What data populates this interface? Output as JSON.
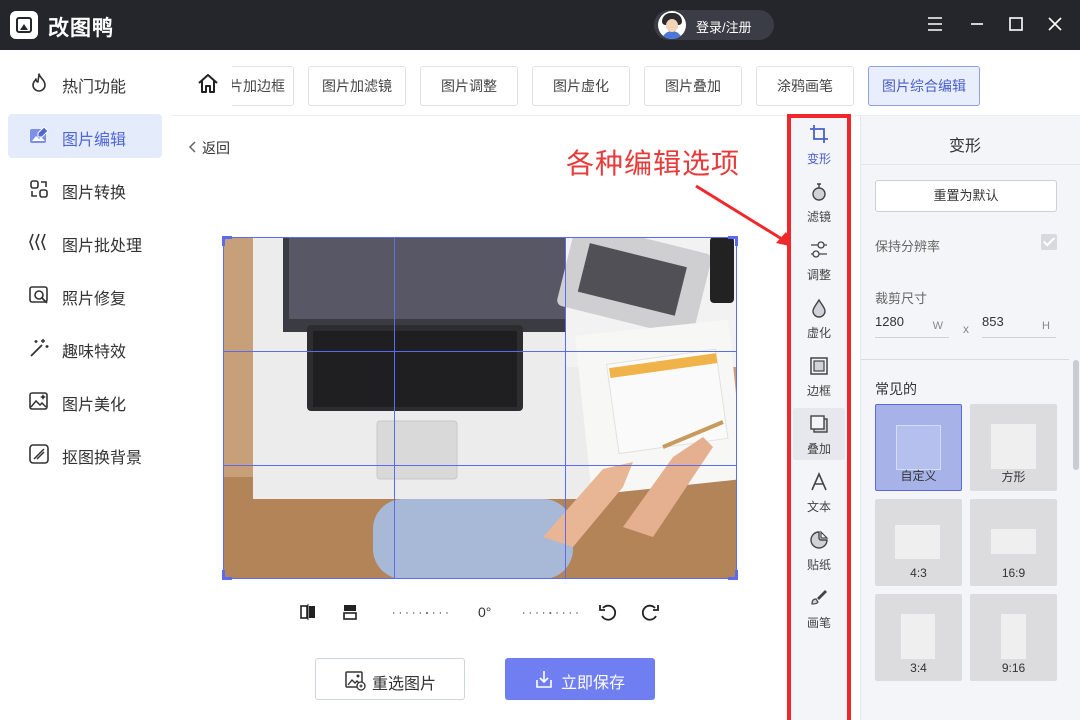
{
  "app": {
    "name": "改图鸭",
    "login_label": "登录/注册"
  },
  "window_controls": [
    "menu-icon",
    "minimize-icon",
    "maximize-icon",
    "close-icon"
  ],
  "sidebar": {
    "items": [
      {
        "label": "热门功能",
        "icon": "flame-icon",
        "active": false
      },
      {
        "label": "图片编辑",
        "icon": "image-edit-icon",
        "active": true
      },
      {
        "label": "图片转换",
        "icon": "convert-icon",
        "active": false
      },
      {
        "label": "图片批处理",
        "icon": "batch-icon",
        "active": false
      },
      {
        "label": "照片修复",
        "icon": "repair-icon",
        "active": false
      },
      {
        "label": "趣味特效",
        "icon": "magic-wand-icon",
        "active": false
      },
      {
        "label": "图片美化",
        "icon": "beautify-icon",
        "active": false
      },
      {
        "label": "抠图换背景",
        "icon": "cutout-icon",
        "active": false
      }
    ]
  },
  "tabs": [
    {
      "label": "片加边框",
      "active": false
    },
    {
      "label": "图片加滤镜",
      "active": false
    },
    {
      "label": "图片调整",
      "active": false
    },
    {
      "label": "图片虚化",
      "active": false
    },
    {
      "label": "图片叠加",
      "active": false
    },
    {
      "label": "涂鸦画笔",
      "active": false
    },
    {
      "label": "图片综合编辑",
      "active": true
    }
  ],
  "back_label": "返回",
  "annotation": "各种编辑选项",
  "rotation": {
    "angle_label": "0°"
  },
  "buttons": {
    "reselect": "重选图片",
    "save": "立即保存"
  },
  "tools": [
    {
      "label": "变形",
      "icon": "transform-icon",
      "selected": true
    },
    {
      "label": "滤镜",
      "icon": "filter-icon",
      "selected": false
    },
    {
      "label": "调整",
      "icon": "adjust-icon",
      "selected": false
    },
    {
      "label": "虚化",
      "icon": "blur-icon",
      "selected": false
    },
    {
      "label": "边框",
      "icon": "border-icon",
      "selected": false
    },
    {
      "label": "叠加",
      "icon": "overlay-icon",
      "selected": false
    },
    {
      "label": "文本",
      "icon": "text-icon",
      "selected": false
    },
    {
      "label": "贴纸",
      "icon": "sticker-icon",
      "selected": false
    },
    {
      "label": "画笔",
      "icon": "brush-icon",
      "selected": false
    }
  ],
  "panel": {
    "title": "变形",
    "reset_label": "重置为默认",
    "keep_resolution_label": "保持分辨率",
    "keep_resolution_checked": true,
    "crop_size_label": "裁剪尺寸",
    "width_value": "1280",
    "width_unit": "W",
    "times_label": "x",
    "height_value": "853",
    "height_unit": "H",
    "common_label": "常见的",
    "presets": [
      {
        "label": "自定义",
        "active": true
      },
      {
        "label": "方形",
        "active": false
      },
      {
        "label": "4:3",
        "active": false
      },
      {
        "label": "16:9",
        "active": false
      },
      {
        "label": "3:4",
        "active": false
      },
      {
        "label": "9:16",
        "active": false
      }
    ]
  }
}
